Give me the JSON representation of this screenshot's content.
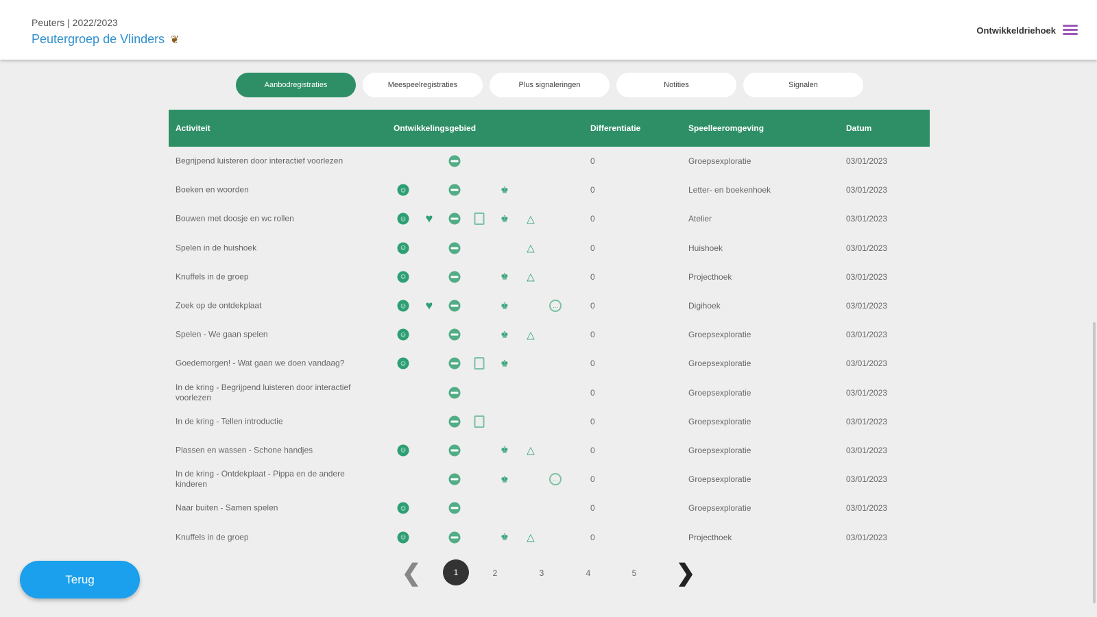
{
  "header": {
    "subtitle": "Peuters | 2022/2023",
    "title": "Peutergroep de Vlinders",
    "title_icon": "butterfly-icon",
    "right_label": "Ontwikkeldriehoek"
  },
  "tabs": [
    {
      "label": "Aanbodregistraties",
      "active": true
    },
    {
      "label": "Meespeelregistraties",
      "active": false
    },
    {
      "label": "Plus signaleringen",
      "active": false
    },
    {
      "label": "Notities",
      "active": false
    },
    {
      "label": "Signalen",
      "active": false
    }
  ],
  "table": {
    "headers": {
      "activity": "Activiteit",
      "domain": "Ontwikkelingsgebied",
      "differentiation": "Differentiatie",
      "environment": "Speelleeromgeving",
      "date": "Datum"
    },
    "rows": [
      {
        "activity": "Begrijpend luisteren door interactief voorlezen",
        "icons": [
          0,
          0,
          1,
          0,
          0,
          0,
          0
        ],
        "diff": "0",
        "env": "Groepsexploratie",
        "date": "03/01/2023"
      },
      {
        "activity": "Boeken en woorden",
        "icons": [
          1,
          0,
          1,
          0,
          1,
          0,
          0
        ],
        "diff": "0",
        "env": "Letter- en boekenhoek",
        "date": "03/01/2023"
      },
      {
        "activity": "Bouwen met doosje en wc rollen",
        "icons": [
          1,
          1,
          1,
          1,
          1,
          1,
          0
        ],
        "diff": "0",
        "env": "Atelier",
        "date": "03/01/2023"
      },
      {
        "activity": "Spelen in de huishoek",
        "icons": [
          1,
          0,
          1,
          0,
          0,
          1,
          0
        ],
        "diff": "0",
        "env": "Huishoek",
        "date": "03/01/2023"
      },
      {
        "activity": "Knuffels in de groep",
        "icons": [
          1,
          0,
          1,
          0,
          1,
          1,
          0
        ],
        "diff": "0",
        "env": "Projecthoek",
        "date": "03/01/2023"
      },
      {
        "activity": "Zoek op de ontdekplaat",
        "icons": [
          1,
          1,
          1,
          0,
          1,
          0,
          1
        ],
        "diff": "0",
        "env": "Digihoek",
        "date": "03/01/2023"
      },
      {
        "activity": "Spelen - We gaan spelen",
        "icons": [
          1,
          0,
          1,
          0,
          1,
          1,
          0
        ],
        "diff": "0",
        "env": "Groepsexploratie",
        "date": "03/01/2023"
      },
      {
        "activity": "Goedemorgen! - Wat gaan we doen vandaag?",
        "icons": [
          1,
          0,
          1,
          1,
          1,
          0,
          0
        ],
        "diff": "0",
        "env": "Groepsexploratie",
        "date": "03/01/2023"
      },
      {
        "activity": "In de kring - Begrijpend luisteren door interactief voorlezen",
        "icons": [
          0,
          0,
          1,
          0,
          0,
          0,
          0
        ],
        "diff": "0",
        "env": "Groepsexploratie",
        "date": "03/01/2023"
      },
      {
        "activity": "In de kring - Tellen introductie",
        "icons": [
          0,
          0,
          1,
          1,
          0,
          0,
          0
        ],
        "diff": "0",
        "env": "Groepsexploratie",
        "date": "03/01/2023"
      },
      {
        "activity": "Plassen en wassen - Schone handjes",
        "icons": [
          1,
          0,
          1,
          0,
          1,
          1,
          0
        ],
        "diff": "0",
        "env": "Groepsexploratie",
        "date": "03/01/2023"
      },
      {
        "activity": "In de kring - Ontdekplaat - Pippa en de andere kinderen",
        "icons": [
          0,
          0,
          1,
          0,
          1,
          0,
          1
        ],
        "diff": "0",
        "env": "Groepsexploratie",
        "date": "03/01/2023"
      },
      {
        "activity": "Naar buiten - Samen spelen",
        "icons": [
          1,
          0,
          1,
          0,
          0,
          0,
          0
        ],
        "diff": "0",
        "env": "Groepsexploratie",
        "date": "03/01/2023"
      },
      {
        "activity": "Knuffels in de groep",
        "icons": [
          1,
          0,
          1,
          0,
          1,
          1,
          0
        ],
        "diff": "0",
        "env": "Projecthoek",
        "date": "03/01/2023"
      }
    ]
  },
  "domain_icons": [
    "smiley-icon",
    "heart-icon",
    "speech-icon",
    "document-icon",
    "people-icon",
    "triangle-icon",
    "chat-bubble-icon"
  ],
  "pagination": {
    "pages": [
      "1",
      "2",
      "3",
      "4",
      "5"
    ],
    "current": "1",
    "prev_icon": "chevron-left-icon",
    "next_icon": "chevron-right-icon"
  },
  "back_button": "Terug",
  "colors": {
    "primary_green": "#2e8f66",
    "title_blue": "#2e8fce",
    "back_button_blue": "#1aa0ec",
    "menu_purple": "#9b59b6"
  }
}
